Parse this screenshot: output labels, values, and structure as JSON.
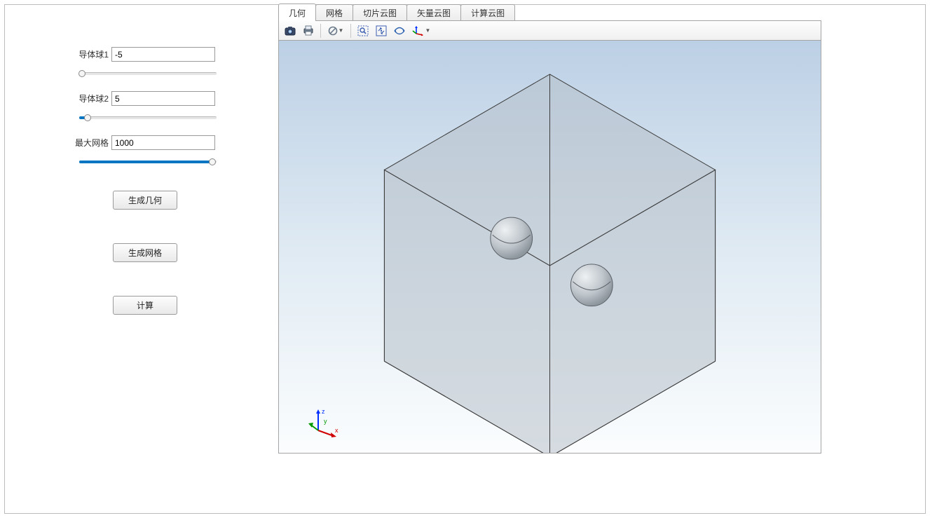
{
  "sidebar": {
    "field1": {
      "label": "导体球1",
      "value": "-5",
      "slider_pct": 2
    },
    "field2": {
      "label": "导体球2",
      "value": "5",
      "slider_pct": 6
    },
    "field3": {
      "label": "最大网格",
      "value": "1000",
      "slider_pct": 97
    },
    "buttons": {
      "gen_geom": "生成几何",
      "gen_mesh": "生成网格",
      "compute": "计算"
    }
  },
  "tabs": [
    {
      "id": "geom",
      "label": "几何",
      "active": true
    },
    {
      "id": "mesh",
      "label": "网格",
      "active": false
    },
    {
      "id": "slice",
      "label": "切片云图",
      "active": false
    },
    {
      "id": "vector",
      "label": "矢量云图",
      "active": false
    },
    {
      "id": "calc",
      "label": "计算云图",
      "active": false
    }
  ],
  "toolbar": {
    "camera_icon": "camera-icon",
    "print_icon": "print-icon",
    "cancel_icon": "cancel-icon",
    "zoom_box_icon": "zoom-box-icon",
    "fit_icon": "fit-view-icon",
    "rotate_icon": "rotate-view-icon",
    "axes_icon": "axes-orientation-icon"
  },
  "triad": {
    "x": "x",
    "y": "y",
    "z": "z"
  }
}
